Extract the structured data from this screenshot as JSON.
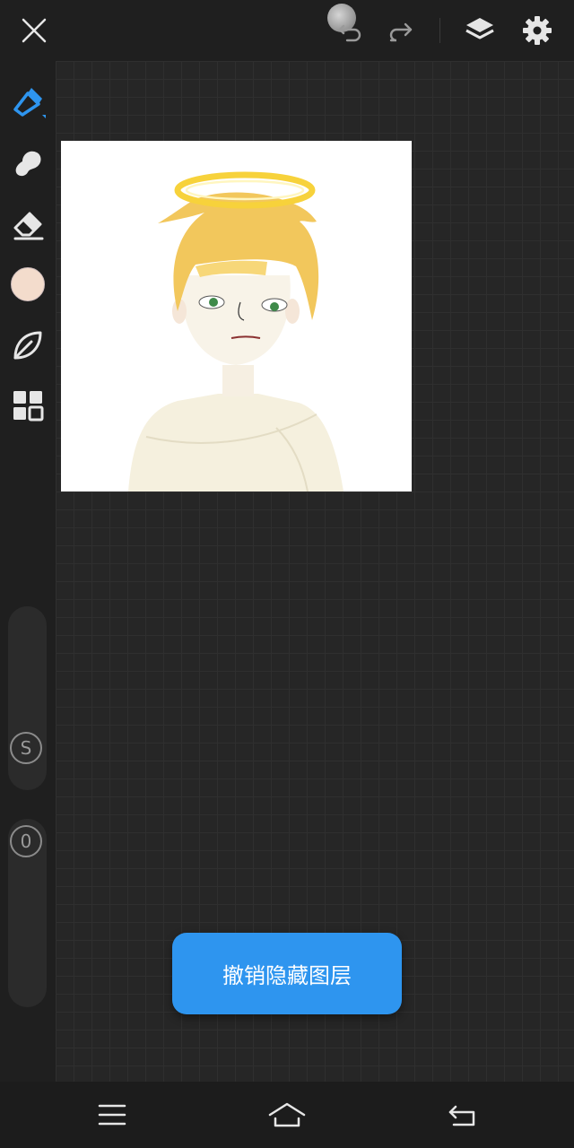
{
  "topbar": {
    "close_icon": "close-icon",
    "undo_icon": "undo-icon",
    "redo_icon": "redo-icon",
    "layers_icon": "layers-icon",
    "settings_icon": "gear-icon"
  },
  "tools": [
    {
      "name": "brush",
      "icon": "brush-icon",
      "active": true
    },
    {
      "name": "smudge",
      "icon": "smudge-icon"
    },
    {
      "name": "eraser",
      "icon": "eraser-icon"
    },
    {
      "name": "color",
      "icon": "color-swatch",
      "color": "#f3dccc"
    },
    {
      "name": "leaf",
      "icon": "leaf-icon"
    },
    {
      "name": "grid",
      "icon": "apps-grid-icon"
    }
  ],
  "sliders": {
    "size_label": "S",
    "opacity_label": "0"
  },
  "toast": {
    "message": "撤销隐藏图层"
  },
  "colors": {
    "accent": "#2e95ef",
    "active_tool": "#2e95ef"
  }
}
